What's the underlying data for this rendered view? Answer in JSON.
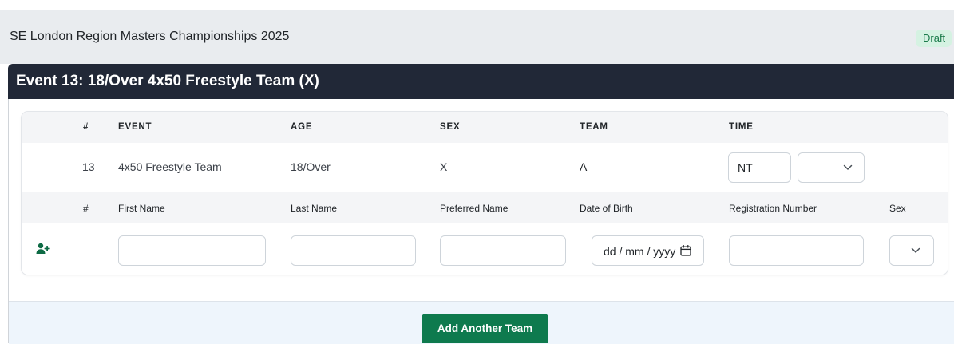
{
  "header": {
    "title": "SE London Region Masters Championships 2025",
    "status_badge": "Draft"
  },
  "event": {
    "title": "Event 13: 18/Over 4x50 Freestyle Team (X)"
  },
  "team_table": {
    "columns": [
      "#",
      "EVENT",
      "AGE",
      "SEX",
      "TEAM",
      "TIME"
    ],
    "row": {
      "number": "13",
      "event": "4x50 Freestyle Team",
      "age": "18/Over",
      "sex": "X",
      "team": "A",
      "time_value": "NT",
      "time_unit_selected": ""
    }
  },
  "swimmer_table": {
    "columns": [
      "#",
      "First Name",
      "Last Name",
      "Preferred Name",
      "Date of Birth",
      "Registration Number",
      "Sex"
    ],
    "row": {
      "first_name": "",
      "last_name": "",
      "preferred_name": "",
      "date_placeholder": "dd / mm / yyyy",
      "registration_number": "",
      "sex_selected": ""
    },
    "add_icon": "user-plus-icon"
  },
  "actions": {
    "add_team_label": "Add Another Team"
  },
  "colors": {
    "event_header_bg": "#212837",
    "primary_button": "#0e7a4e",
    "badge_bg": "#d5f2e2",
    "badge_text": "#1a7a4a",
    "icon_green": "#0e6b45"
  }
}
